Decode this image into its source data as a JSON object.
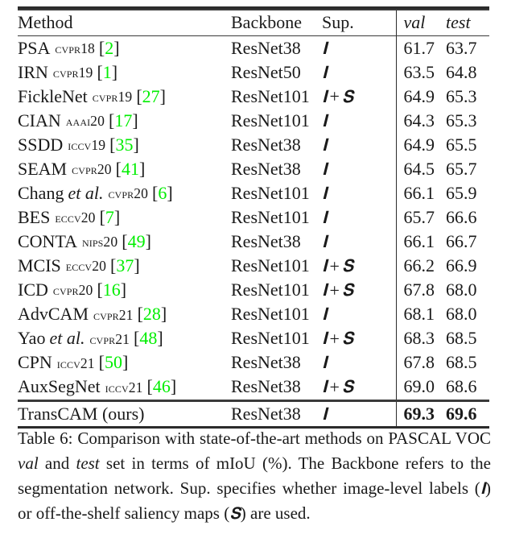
{
  "table": {
    "columns": [
      {
        "key": "method",
        "label": "Method",
        "italic": false
      },
      {
        "key": "backbone",
        "label": "Backbone",
        "italic": false
      },
      {
        "key": "sup",
        "label": "Sup.",
        "italic": false
      },
      {
        "key": "val",
        "label": "val",
        "italic": true
      },
      {
        "key": "test",
        "label": "test",
        "italic": true
      }
    ],
    "rows": [
      {
        "name": "PSA",
        "etal": "",
        "venue": "CVPR18",
        "cite": "2",
        "backbone": "ResNet38",
        "sup": "I",
        "val": "61.7",
        "test": "63.7",
        "highlight": false
      },
      {
        "name": "IRN",
        "etal": "",
        "venue": "CVPR19",
        "cite": "1",
        "backbone": "ResNet50",
        "sup": "I",
        "val": "63.5",
        "test": "64.8",
        "highlight": false
      },
      {
        "name": "FickleNet",
        "etal": "",
        "venue": "CVPR19",
        "cite": "27",
        "backbone": "ResNet101",
        "sup": "I + S",
        "val": "64.9",
        "test": "65.3",
        "highlight": false
      },
      {
        "name": "CIAN",
        "etal": "",
        "venue": "AAAI20",
        "cite": "17",
        "backbone": "ResNet101",
        "sup": "I",
        "val": "64.3",
        "test": "65.3",
        "highlight": false
      },
      {
        "name": "SSDD",
        "etal": "",
        "venue": "ICCV19",
        "cite": "35",
        "backbone": "ResNet38",
        "sup": "I",
        "val": "64.9",
        "test": "65.5",
        "highlight": false
      },
      {
        "name": "SEAM",
        "etal": "",
        "venue": "CVPR20",
        "cite": "41",
        "backbone": "ResNet38",
        "sup": "I",
        "val": "64.5",
        "test": "65.7",
        "highlight": false
      },
      {
        "name": "Chang",
        "etal": "et al.",
        "venue": "CVPR20",
        "cite": "6",
        "backbone": "ResNet101",
        "sup": "I",
        "val": "66.1",
        "test": "65.9",
        "highlight": false
      },
      {
        "name": "BES",
        "etal": "",
        "venue": "ECCV20",
        "cite": "7",
        "backbone": "ResNet101",
        "sup": "I",
        "val": "65.7",
        "test": "66.6",
        "highlight": false
      },
      {
        "name": "CONTA",
        "etal": "",
        "venue": "NIPS20",
        "cite": "49",
        "backbone": "ResNet38",
        "sup": "I",
        "val": "66.1",
        "test": "66.7",
        "highlight": false
      },
      {
        "name": "MCIS",
        "etal": "",
        "venue": "ECCV20",
        "cite": "37",
        "backbone": "ResNet101",
        "sup": "I + S",
        "val": "66.2",
        "test": "66.9",
        "highlight": false
      },
      {
        "name": "ICD",
        "etal": "",
        "venue": "CVPR20",
        "cite": "16",
        "backbone": "ResNet101",
        "sup": "I + S",
        "val": "67.8",
        "test": "68.0",
        "highlight": false
      },
      {
        "name": "AdvCAM",
        "etal": "",
        "venue": "CVPR21",
        "cite": "28",
        "backbone": "ResNet101",
        "sup": "I",
        "val": "68.1",
        "test": "68.0",
        "highlight": false
      },
      {
        "name": "Yao",
        "etal": "et al.",
        "venue": "CVPR21",
        "cite": "48",
        "backbone": "ResNet101",
        "sup": "I + S",
        "val": "68.3",
        "test": "68.5",
        "highlight": false
      },
      {
        "name": "CPN",
        "etal": "",
        "venue": "ICCV21",
        "cite": "50",
        "backbone": "ResNet38",
        "sup": "I",
        "val": "67.8",
        "test": "68.5",
        "highlight": false
      },
      {
        "name": "AuxSegNet",
        "etal": "",
        "venue": "ICCV21",
        "cite": "46",
        "backbone": "ResNet38",
        "sup": "I + S",
        "val": "69.0",
        "test": "68.6",
        "highlight": false
      }
    ],
    "ours_row": {
      "name": "TransCAM (ours)",
      "etal": "",
      "venue": "",
      "cite": "",
      "backbone": "ResNet38",
      "sup": "I",
      "val": "69.3",
      "test": "69.6",
      "highlight": true
    },
    "citation_color": "#00ee00",
    "rule_color": "#2b2b2b"
  },
  "caption": {
    "label": "Table 6:",
    "text_1": " Comparison with state-of-the-art methods on PASCAL VOC ",
    "ital_1": "val",
    "text_2": " and ",
    "ital_2": "test",
    "text_3": " set in terms of mIoU (%). The Backbone refers to the segmentation network. Sup. specifies whether image-level labels (",
    "sym_1": "I",
    "text_4": ") or off-the-shelf saliency maps (",
    "sym_2": "S",
    "text_5": ") are used."
  }
}
